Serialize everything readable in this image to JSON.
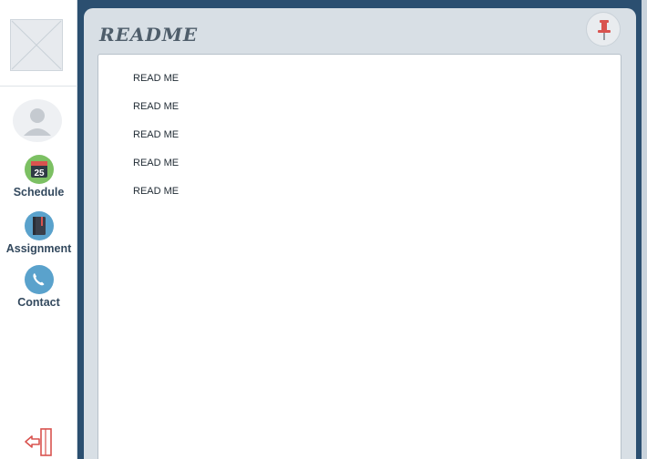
{
  "sidebar": {
    "logo_icon": "image-placeholder-icon",
    "avatar_icon": "user-avatar-icon",
    "items": [
      {
        "label": "Schedule",
        "icon": "calendar-icon",
        "icon_text": "25"
      },
      {
        "label": "Assignment",
        "icon": "notebook-icon"
      },
      {
        "label": "Contact",
        "icon": "phone-icon"
      }
    ],
    "logout_icon": "logout-icon"
  },
  "main": {
    "title": "README",
    "pin_icon": "pushpin-icon",
    "items": [
      "READ ME",
      "READ ME",
      "READ ME",
      "READ ME",
      "READ ME"
    ]
  },
  "colors": {
    "background": "#2b4f70",
    "panel": "#d8dfe5",
    "schedule_icon_bg": "#7cc063",
    "assignment_icon_bg": "#5aa2cc",
    "contact_icon_bg": "#5aa2cc",
    "pin": "#d9534f",
    "logout": "#d9534f"
  }
}
